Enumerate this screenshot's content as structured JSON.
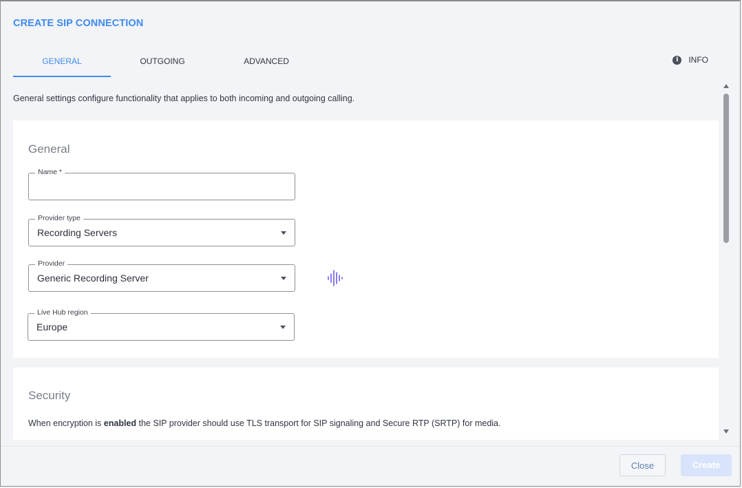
{
  "dialog": {
    "title": "CREATE SIP CONNECTION"
  },
  "tabs": [
    {
      "label": "GENERAL",
      "active": true
    },
    {
      "label": "OUTGOING",
      "active": false
    },
    {
      "label": "ADVANCED",
      "active": false
    }
  ],
  "info": {
    "label": "INFO",
    "icon": "info-icon"
  },
  "description": "General settings configure functionality that applies to both incoming and outgoing calling.",
  "general": {
    "heading": "General",
    "name": {
      "label": "Name *",
      "value": ""
    },
    "provider_type": {
      "label": "Provider type",
      "value": "Recording Servers"
    },
    "provider": {
      "label": "Provider",
      "value": "Generic Recording Server",
      "icon": "audio-wave-icon"
    },
    "live_hub_region": {
      "label": "Live Hub region",
      "value": "Europe"
    }
  },
  "security": {
    "heading": "Security",
    "text_before": "When encryption is ",
    "text_bold": "enabled",
    "text_after": " the SIP provider should use TLS transport for SIP signaling and Secure RTP (SRTP) for media."
  },
  "footer": {
    "close_label": "Close",
    "create_label": "Create"
  },
  "colors": {
    "accent": "#3d8af0",
    "create_disabled": "#d9e3fb",
    "wave": "#6b5cf0"
  }
}
